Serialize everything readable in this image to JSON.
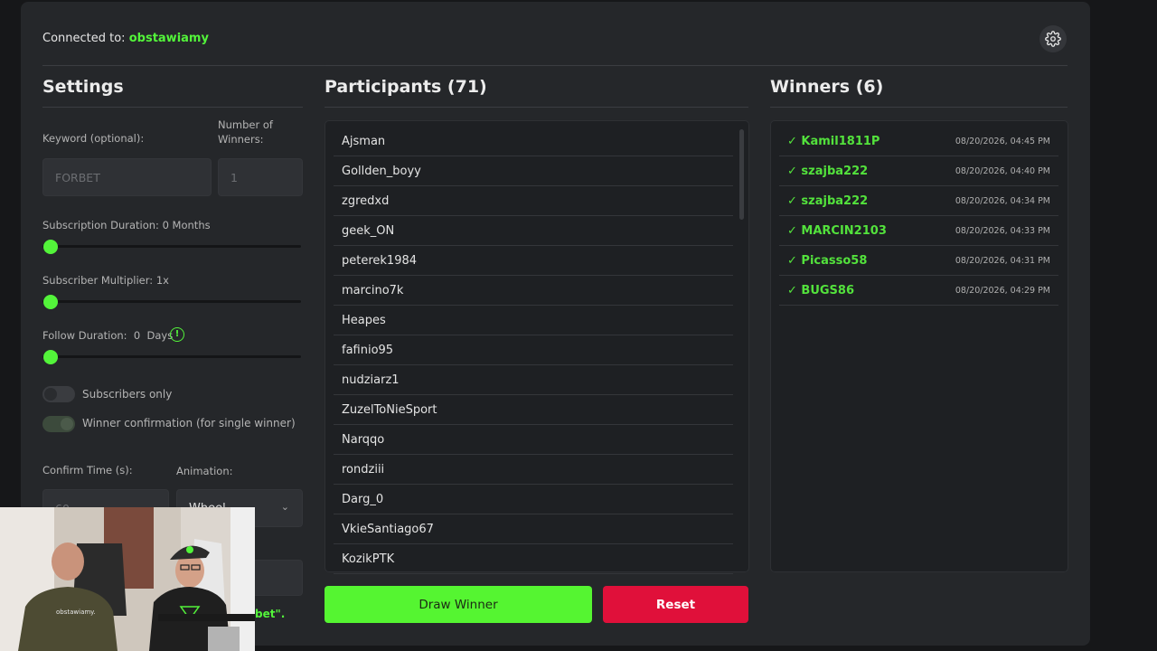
{
  "header": {
    "connected_prefix": "Connected to:",
    "channel": "obstawiamy"
  },
  "settings": {
    "title": "Settings",
    "keyword_label": "Keyword (optional):",
    "keyword_placeholder": "FORBET",
    "winners_label": "Number of Winners:",
    "winners_placeholder": "1",
    "sub_duration_label": "Subscription Duration: 0 Months",
    "sub_multiplier_label": "Subscriber Multiplier: 1x",
    "follow_label": "Follow Duration:  0  Days",
    "subs_only_label": "Subscribers only",
    "winner_confirm_label": "Winner confirmation (for single winner)",
    "confirm_time_label": "Confirm Time (s):",
    "confirm_time_value": "60",
    "animation_label": "Animation:",
    "animation_value": "Wheel",
    "partial_bottom_text": "bet\"."
  },
  "participants": {
    "title": "Participants (71)",
    "items": [
      "Ajsman",
      "Gollden_boyy",
      "zgredxd",
      "geek_ON",
      "peterek1984",
      "marcino7k",
      "Heapes",
      "fafinio95",
      "nudziarz1",
      "ZuzelToNieSport",
      "Narqqo",
      "rondziii",
      "Darg_0",
      "VkieSantiago67",
      "KozikPTK"
    ]
  },
  "winners": {
    "title": "Winners (6)",
    "items": [
      {
        "name": "✓ Kamil1811P",
        "time": "08/20/2026, 04:45 PM"
      },
      {
        "name": "✓ szajba222",
        "time": "08/20/2026, 04:40 PM"
      },
      {
        "name": "✓ szajba222",
        "time": "08/20/2026, 04:34 PM"
      },
      {
        "name": "✓ MARCIN2103",
        "time": "08/20/2026, 04:33 PM"
      },
      {
        "name": "✓ Picasso58",
        "time": "08/20/2026, 04:31 PM"
      },
      {
        "name": "✓ BUGS86",
        "time": "08/20/2026, 04:29 PM"
      }
    ]
  },
  "buttons": {
    "draw": "Draw Winner",
    "reset": "Reset"
  },
  "webcam_shirt_text": "obstawiamy.",
  "colors": {
    "accent": "#53f43a",
    "reset": "#e0103a",
    "panel": "#25272a"
  }
}
